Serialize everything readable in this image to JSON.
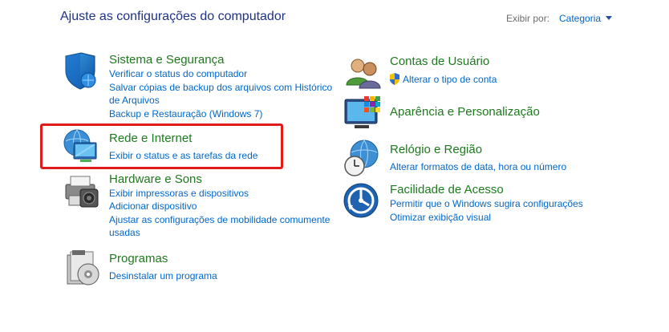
{
  "header": {
    "title": "Ajuste as configurações do computador",
    "view_by_label": "Exibir por:",
    "view_by_value": "Categoria"
  },
  "categories": {
    "system": {
      "title": "Sistema e Segurança",
      "links": [
        "Verificar o status do computador",
        "Salvar cópias de backup dos arquivos com Histórico",
        "de Arquivos",
        "Backup e Restauração (Windows 7)"
      ],
      "icon": "shield-icon"
    },
    "network": {
      "title": "Rede e Internet",
      "links": [
        "Exibir o status e as tarefas da rede"
      ],
      "icon": "globe-network-icon"
    },
    "hardware": {
      "title": "Hardware e Sons",
      "links": [
        "Exibir impressoras e dispositivos",
        "Adicionar dispositivo",
        "Ajustar as configurações de mobilidade comumente",
        "usadas"
      ],
      "icon": "printer-icon"
    },
    "programs": {
      "title": "Programas",
      "links": [
        "Desinstalar um programa"
      ],
      "icon": "programs-disc-icon"
    },
    "users": {
      "title": "Contas de Usuário",
      "links": [
        "Alterar o tipo de conta"
      ],
      "icon": "users-icon"
    },
    "appearance": {
      "title": "Aparência e Personalização",
      "links": [],
      "icon": "monitor-color-icon"
    },
    "clock": {
      "title": "Relógio e Região",
      "links": [
        "Alterar formatos de data, hora ou número"
      ],
      "icon": "clock-globe-icon"
    },
    "access": {
      "title": "Facilidade de Acesso",
      "links": [
        "Permitir que o Windows sugira configurações",
        "Otimizar exibição visual"
      ],
      "icon": "accessibility-icon"
    }
  },
  "colors": {
    "title": "#1e3287",
    "category_title": "#1e7a1e",
    "link": "#0066cc",
    "highlight": "#e01b1b"
  }
}
